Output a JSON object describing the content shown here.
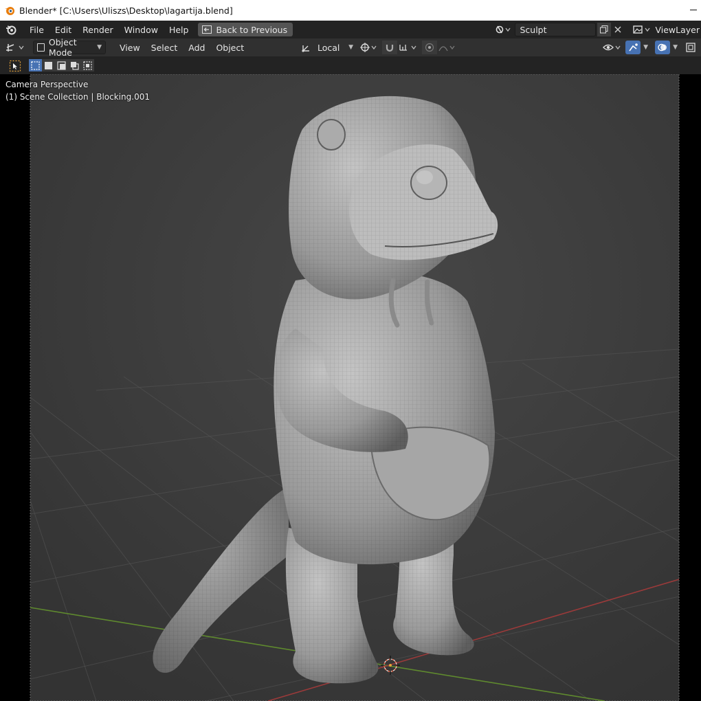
{
  "window": {
    "title": "Blender* [C:\\Users\\Uliszs\\Desktop\\lagartija.blend]"
  },
  "menubar": {
    "items": [
      "File",
      "Edit",
      "Render",
      "Window",
      "Help"
    ],
    "back_button": "Back to Previous",
    "workspace": "Sculpt",
    "view_layer": "ViewLayer"
  },
  "header": {
    "mode": "Object Mode",
    "menus": [
      "View",
      "Select",
      "Add",
      "Object"
    ],
    "transform_orientation": "Local"
  },
  "viewport": {
    "view_name": "Camera Perspective",
    "collection_info": "(1) Scene Collection | Blocking.001",
    "accent_blue": "#4772b3",
    "x_axis_color": "#9b3a3a",
    "y_axis_color": "#5f8a2e"
  }
}
